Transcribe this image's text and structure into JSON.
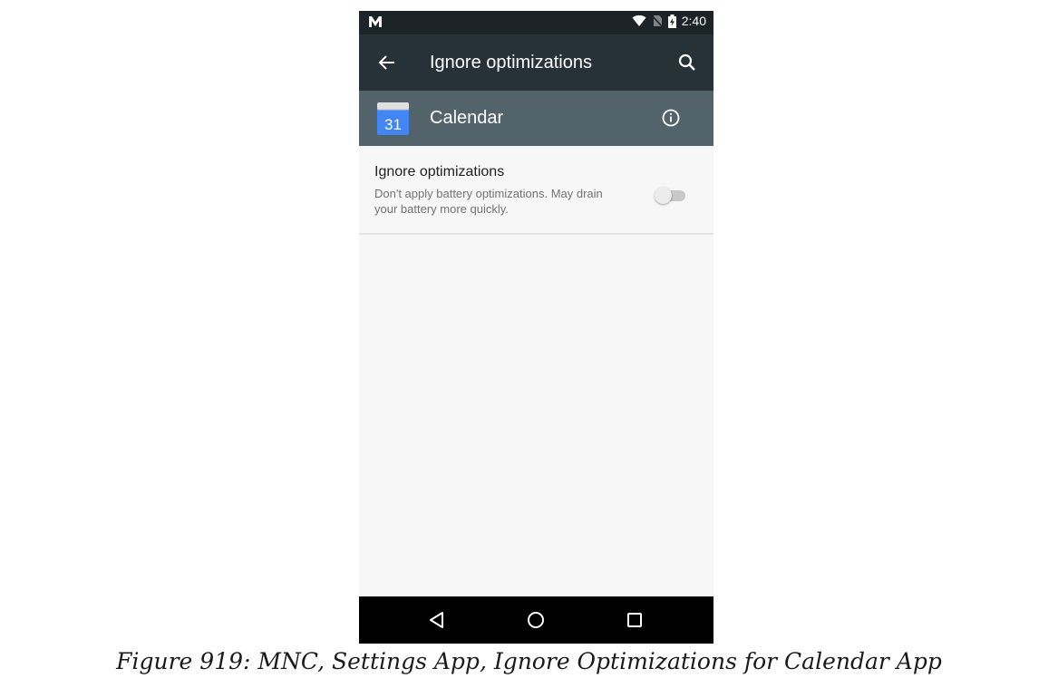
{
  "status_bar": {
    "time": "2:40",
    "icons": [
      "m-logo-icon",
      "wifi-icon",
      "no-sim-icon",
      "battery-charging-icon"
    ]
  },
  "toolbar": {
    "title": "Ignore optimizations",
    "back_icon": "arrow-back-icon",
    "search_icon": "search-icon"
  },
  "app_header": {
    "app_name": "Calendar",
    "calendar_day": "31",
    "info_icon": "info-icon"
  },
  "setting": {
    "label": "Ignore optimizations",
    "summary": "Don't apply battery optimizations. May drain your battery more quickly.",
    "toggle_on": false
  },
  "nav_bar": {
    "icons": [
      "nav-back-icon",
      "nav-home-icon",
      "nav-recents-icon"
    ]
  },
  "caption": "Figure 919: MNC, Settings App, Ignore Optimizations for Calendar App",
  "colors": {
    "status_bar": "#1c2428",
    "toolbar": "#263238",
    "app_header": "#53636b",
    "background": "#f7f7f7",
    "calendar_blue": "#4285f4"
  }
}
